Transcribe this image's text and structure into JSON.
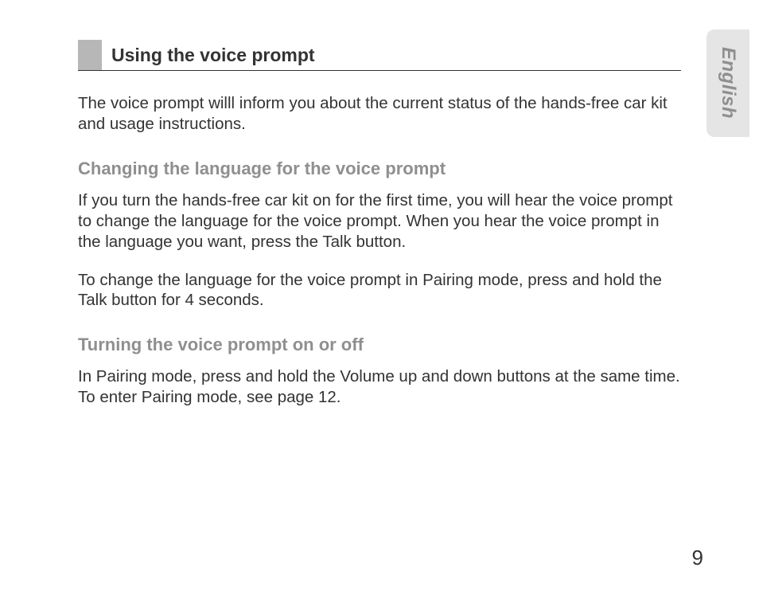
{
  "sideTab": {
    "label": "English"
  },
  "section": {
    "title": "Using the voice prompt"
  },
  "intro": "The voice prompt willl inform you about the current status of the hands-free car kit and usage instructions.",
  "sub1": {
    "heading": "Changing the language for the voice prompt",
    "p1": "If you turn the hands-free car kit on for the first time, you will hear the voice prompt to change the language for the voice prompt. When you hear the voice prompt in the language you want, press the Talk button.",
    "p2": "To change the language for the voice prompt in Pairing mode, press and hold the Talk button for 4 seconds."
  },
  "sub2": {
    "heading": "Turning the voice prompt on or off",
    "p1": "In Pairing mode, press and hold the Volume up and down buttons at the same time. To enter Pairing mode, see page 12."
  },
  "pageNumber": "9"
}
